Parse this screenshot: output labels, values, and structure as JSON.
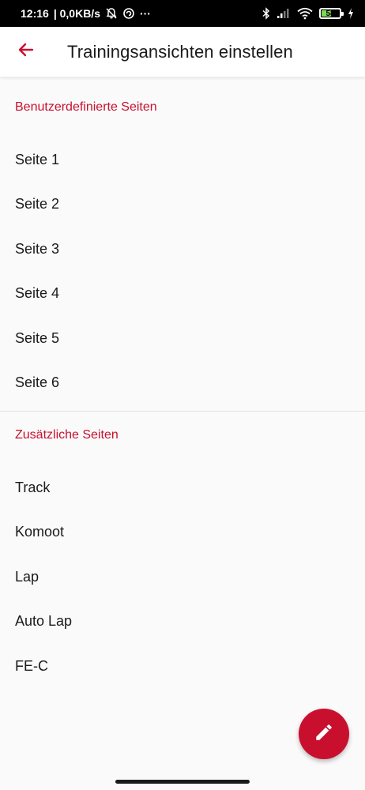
{
  "status_bar": {
    "time": "12:16",
    "speed": "| 0,0KB/s",
    "more": "···",
    "battery_level": "58",
    "battery_percent": 58
  },
  "app_bar": {
    "title": "Trainingsansichten einstellen"
  },
  "sections": [
    {
      "header": "Benutzerdefinierte Seiten",
      "items": [
        "Seite 1",
        "Seite 2",
        "Seite 3",
        "Seite 4",
        "Seite 5",
        "Seite 6"
      ]
    },
    {
      "header": "Zusätzliche Seiten",
      "items": [
        "Track",
        "Komoot",
        "Lap",
        "Auto Lap",
        "FE-C"
      ]
    }
  ],
  "colors": {
    "accent": "#c8102e",
    "background": "#fafafa"
  },
  "icons": {
    "back": "arrow-left-icon",
    "fab": "pencil-icon"
  }
}
